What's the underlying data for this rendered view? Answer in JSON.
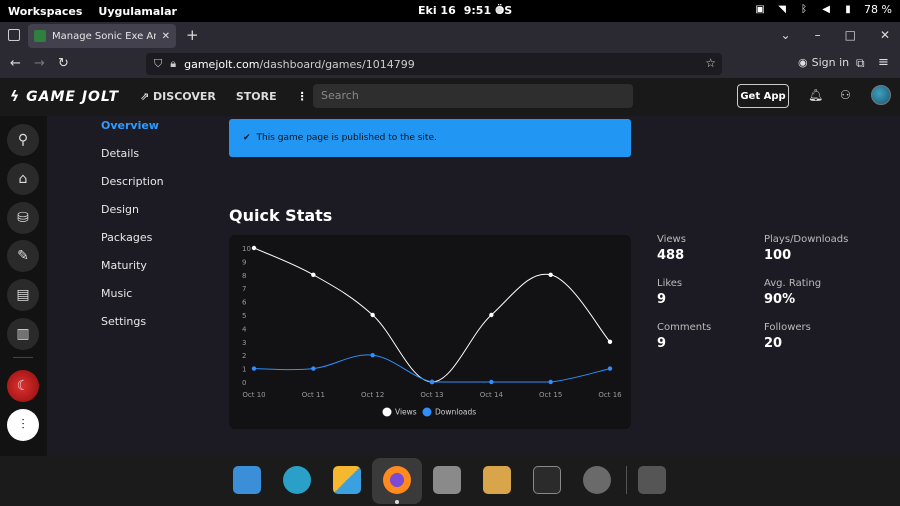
{
  "os": {
    "workspaces": "Workspaces",
    "apps": "Uygulamalar",
    "date": "Eki 16",
    "time": "9:51 ÖS",
    "battery": "78 %"
  },
  "browser": {
    "tab_title": "Manage Sonic Exe And The",
    "url_host": "gamejolt.com",
    "url_path": "/dashboard/games/1014799",
    "sign_in": "Sign in"
  },
  "gj": {
    "logo": "GAME JOLT",
    "nav": [
      "DISCOVER",
      "STORE"
    ],
    "more": "⋮",
    "search_placeholder": "Search",
    "get_app": "Get App"
  },
  "sidebar": {
    "items": [
      "Overview",
      "Details",
      "Description",
      "Design",
      "Packages",
      "Maturity",
      "Music",
      "Settings"
    ],
    "selected": "Overview"
  },
  "notice": "This game page is published to the site.",
  "quick_stats_title": "Quick Stats",
  "chart_data": {
    "type": "line",
    "categories": [
      "Oct 10",
      "Oct 11",
      "Oct 12",
      "Oct 13",
      "Oct 14",
      "Oct 15",
      "Oct 16"
    ],
    "series": [
      {
        "name": "Views",
        "values": [
          10,
          8,
          5,
          0,
          5,
          8,
          3
        ],
        "color": "#ffffff"
      },
      {
        "name": "Downloads",
        "values": [
          1,
          1,
          2,
          0,
          0,
          0,
          1
        ],
        "color": "#2f8fff"
      }
    ],
    "ylim": [
      0,
      10
    ],
    "yticks": [
      "0",
      "1",
      "2",
      "3",
      "4",
      "5",
      "6",
      "7",
      "8",
      "9",
      "10"
    ],
    "legend": "bottom"
  },
  "stats": [
    {
      "label": "Views",
      "value": "488"
    },
    {
      "label": "Plays/Downloads",
      "value": "100"
    },
    {
      "label": "Likes",
      "value": "9"
    },
    {
      "label": "Avg. Rating",
      "value": "90%"
    },
    {
      "label": "Comments",
      "value": "9"
    },
    {
      "label": "Followers",
      "value": "20"
    }
  ]
}
